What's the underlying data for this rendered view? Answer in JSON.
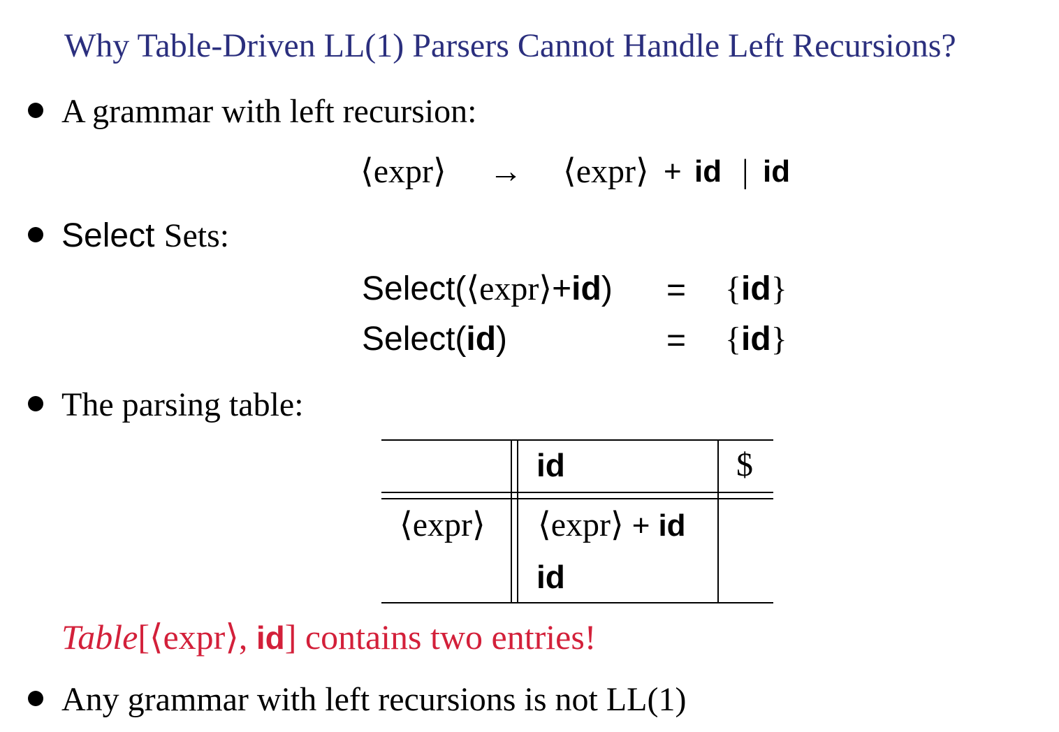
{
  "colors": {
    "title": "#2b2f7e",
    "text": "#000000",
    "highlight": "#d3203a"
  },
  "title": "Why Table-Driven LL(1) Parsers Cannot Handle Left Recursions?",
  "bullets": {
    "grammar": "A grammar with left recursion:",
    "select_sets": {
      "sans_part": "Select ",
      "serif_part": "Sets:"
    },
    "parsing_table": "The parsing table:",
    "conclusion": "Any grammar with left recursions is not LL(1)"
  },
  "grammar_rule": {
    "lhs": "⟨expr⟩",
    "arrow": "→",
    "rhs_nonterminal": "⟨expr⟩",
    "plus": "+",
    "terminal": "id",
    "bar": "|",
    "alt_terminal": "id"
  },
  "select_sets": [
    {
      "func": "Select(",
      "args": [
        {
          "text": "⟨expr⟩",
          "style": "serif"
        },
        {
          "text": "+",
          "style": "sans"
        },
        {
          "text": "id",
          "style": "sans-bold"
        }
      ],
      "close": ")",
      "eq": "=",
      "set_open": "{",
      "set_value": "id",
      "set_close": "}"
    },
    {
      "func": "Select(",
      "args": [
        {
          "text": "id",
          "style": "sans-bold"
        }
      ],
      "close": ")",
      "eq": "=",
      "set_open": "{",
      "set_value": "id",
      "set_close": "}"
    }
  ],
  "parsing_table": {
    "header": [
      "",
      "id",
      "$"
    ],
    "row_label": "⟨expr⟩",
    "entries": [
      {
        "nonterminal": "⟨expr⟩",
        "plus": "+",
        "terminal": "id"
      },
      {
        "terminal": "id"
      }
    ]
  },
  "note": {
    "table_word": "Table",
    "open_bracket": "[",
    "nonterminal": "⟨expr⟩",
    "comma": ",",
    "terminal": "id",
    "close_bracket": "]",
    "rest": " contains two entries!"
  }
}
